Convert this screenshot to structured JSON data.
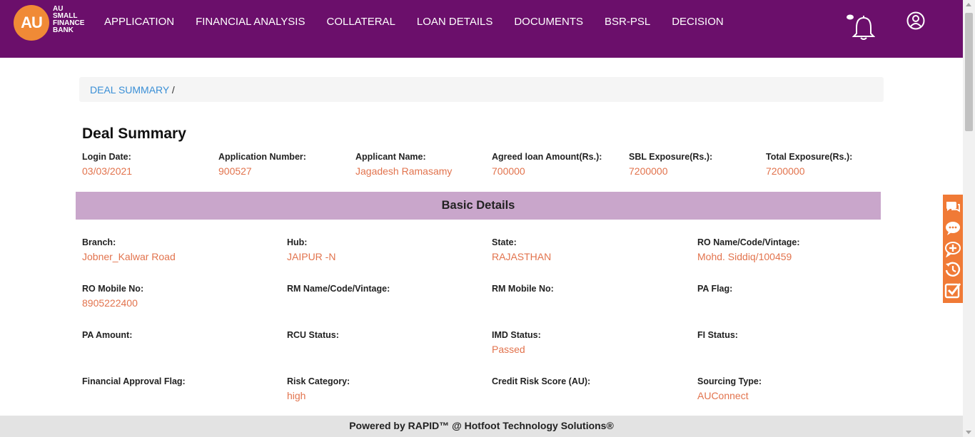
{
  "header": {
    "logo_mark": "AU",
    "logo_lines": [
      "AU",
      "SMALL",
      "FINANCE",
      "BANK"
    ],
    "nav": [
      "APPLICATION",
      "FINANCIAL ANALYSIS",
      "COLLATERAL",
      "LOAN DETAILS",
      "DOCUMENTS",
      "BSR-PSL",
      "DECISION"
    ],
    "icons": [
      "bell-icon",
      "user-icon"
    ]
  },
  "breadcrumb": {
    "link": "DEAL SUMMARY",
    "separator": "/"
  },
  "page_title": "Deal Summary",
  "summary": [
    {
      "label": "Login Date:",
      "value": "03/03/2021"
    },
    {
      "label": "Application Number:",
      "value": "900527"
    },
    {
      "label": "Applicant Name:",
      "value": "Jagadesh Ramasamy"
    },
    {
      "label": "Agreed loan Amount(Rs.):",
      "value": "700000"
    },
    {
      "label": "SBL Exposure(Rs.):",
      "value": "7200000"
    },
    {
      "label": "Total Exposure(Rs.):",
      "value": "7200000"
    }
  ],
  "basic_details": {
    "title": "Basic Details",
    "fields": [
      {
        "label": "Branch:",
        "value": "Jobner_Kalwar Road"
      },
      {
        "label": "Hub:",
        "value": "JAIPUR -N"
      },
      {
        "label": "State:",
        "value": "RAJASTHAN"
      },
      {
        "label": "RO Name/Code/Vintage:",
        "value": "Mohd. Siddiq/100459"
      },
      {
        "label": "RO Mobile No:",
        "value": "8905222400"
      },
      {
        "label": "RM Name/Code/Vintage:",
        "value": ""
      },
      {
        "label": "RM Mobile No:",
        "value": ""
      },
      {
        "label": "PA Flag:",
        "value": ""
      },
      {
        "label": "PA Amount:",
        "value": ""
      },
      {
        "label": "RCU Status:",
        "value": ""
      },
      {
        "label": "IMD Status:",
        "value": "Passed"
      },
      {
        "label": "FI Status:",
        "value": ""
      },
      {
        "label": "Financial Approval Flag:",
        "value": ""
      },
      {
        "label": "Risk Category:",
        "value": "high"
      },
      {
        "label": "Credit Risk Score (AU):",
        "value": ""
      },
      {
        "label": "Sourcing Type:",
        "value": "AUConnect"
      }
    ]
  },
  "side_tools": [
    "chat-icon",
    "comment-icon",
    "add-comment-icon",
    "history-icon",
    "checklist-icon"
  ],
  "footer": "Powered by RAPID™ @ Hotfoot Technology Solutions®",
  "colors": {
    "header_bg": "#6b0f6b",
    "logo": "#f08a36",
    "value_text": "#e2734d",
    "link": "#3a8fd6",
    "section_bg": "#c9a6cb",
    "side_tools_bg": "#f07a36"
  }
}
